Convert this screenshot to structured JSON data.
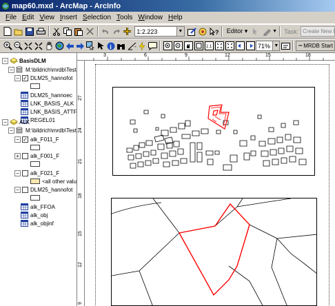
{
  "window": {
    "title": "map60.mxd - ArcMap - ArcInfo"
  },
  "menu": [
    {
      "u": "F",
      "rest": "ile"
    },
    {
      "u": "E",
      "rest": "dit"
    },
    {
      "u": "V",
      "rest": "iew"
    },
    {
      "u": "I",
      "rest": "nsert"
    },
    {
      "u": "S",
      "rest": "election"
    },
    {
      "u": "T",
      "rest": "ools"
    },
    {
      "u": "W",
      "rest": "indow"
    },
    {
      "u": "H",
      "rest": "elp"
    }
  ],
  "toolbar": {
    "scale": "1:2.223",
    "editor_label": "Editor",
    "task_label": "Task:",
    "task_value": "Create New Feat",
    "zoom_percent": "71%",
    "mrdb_label": "MRDB Start"
  },
  "toc": {
    "groups": [
      {
        "name": "BasisDLM",
        "path": "M:\\bildrich\\mrdb\\Test",
        "layers": [
          "DLM25_hannofot",
          "DLM25_hannoec",
          "LNK_BASIS_ALK",
          "LNK_BASIS_ATTF",
          "REGEL01"
        ]
      },
      {
        "name": "ALK",
        "path": "M:\\bildrich\\mrdb\\Test",
        "layers": [
          "alk_F011_F",
          "alk_F001_F",
          "alk_F021_F",
          "<all other valu",
          "DLM25_hannofot",
          "alk_FFOA",
          "alk_obj",
          "alk_objinf"
        ]
      }
    ]
  },
  "ruler": {
    "h": [
      "3",
      "6",
      "9",
      "12",
      "15",
      "18"
    ],
    "v": [
      "27",
      "24",
      "21",
      "18",
      "15",
      "12",
      "9"
    ]
  },
  "colors": {
    "selection": "#ff0000",
    "title_start": "#0a246a",
    "title_end": "#a6caf0"
  }
}
